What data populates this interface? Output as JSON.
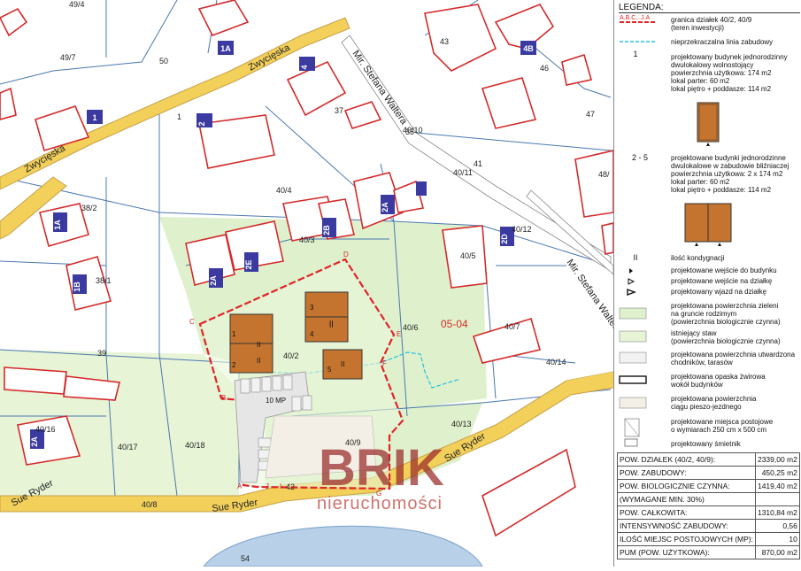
{
  "map": {
    "parcels": [
      "49/4",
      "49/7",
      "50",
      "1",
      "35",
      "37",
      "40/10",
      "41",
      "40/11",
      "40/4",
      "38/2",
      "40/3",
      "38/1",
      "40/12",
      "40/5",
      "48/",
      "47",
      "46",
      "43",
      "39",
      "40/2",
      "40/6",
      "40/7",
      "40/14",
      "40/13",
      "40/16",
      "40/17",
      "40/18",
      "40/8",
      "40/9",
      "42",
      "54"
    ],
    "buildings": [
      "1A",
      "4",
      "4B",
      "1",
      "2",
      "2A",
      "2B",
      "2A",
      "2E",
      "2D",
      "1B",
      "1A",
      "2A"
    ],
    "streets": [
      "Zwycięska",
      "Zwycięska",
      "Mir. Stefana Waltera",
      "Mir. Stefana Waltera",
      "Sue Ryder",
      "Sue Ryder",
      "Sue Ryder"
    ],
    "zone": "05-04",
    "corners": [
      "A",
      "B",
      "C",
      "D",
      "E",
      "F",
      "G",
      "I",
      "J"
    ],
    "parking": "10 MP",
    "new_buildings": [
      {
        "no": "1",
        "tag": "II"
      },
      {
        "no": "2",
        "tag": "II"
      },
      {
        "no": "3",
        "tag": "II"
      },
      {
        "no": "4",
        "tag": "II"
      },
      {
        "no": "5",
        "tag": "II"
      }
    ],
    "watermark": {
      "brand": "BRIK",
      "sub": "nieruchomości"
    }
  },
  "legend": {
    "title": "LEGENDA:",
    "plot_corner_label": "A.B.C...J.A",
    "items": [
      {
        "lines": [
          "granica działek 40/2, 40/9",
          "(teren inwestycji)"
        ]
      },
      {
        "lines": [
          "nieprzekraczalna linia zabudowy"
        ]
      },
      {
        "lines": [
          "projektowany budynek jednorodzinny",
          "dwulokalowy wolnostojący",
          "powierzchnia użytkowa: 174 m2",
          "lokal parter: 60 m2",
          "lokal piętro + poddasze: 114 m2"
        ]
      },
      {
        "lines": [
          "projektowane budynki jednorodzinne",
          "dwulokalowe w zabudowie bliźniaczej",
          "powierzchnia użytkowa: 2 x 174 m2",
          "lokal parter: 60 m2",
          "lokal piętro + poddasze: 114 m2"
        ]
      },
      {
        "lines": [
          "ilość kondygnacji"
        ]
      },
      {
        "lines": [
          "projektowane wejście do budynku"
        ]
      },
      {
        "lines": [
          "projektowane wejście na działkę"
        ]
      },
      {
        "lines": [
          "projektowany wjazd na działkę"
        ]
      },
      {
        "lines": [
          "projektowana powierzchnia zieleni",
          "na gruncie rodzimym",
          "(powierzchnia biologicznie czynna)"
        ]
      },
      {
        "lines": [
          "istniejący staw",
          "(powierzchnia biologicznie czynna)"
        ]
      },
      {
        "lines": [
          "projektowana powierzchnia utwardzona",
          "chodników, tarasów"
        ]
      },
      {
        "lines": [
          "projektowana opaska żwirowa",
          "wokół budynków"
        ]
      },
      {
        "lines": [
          "projektowana powierzchnia",
          "ciągu pieszo-jezdnego"
        ]
      },
      {
        "lines": [
          "projektowane miejsca postojowe",
          "o wymiarach 250 cm x 500 cm"
        ]
      },
      {
        "lines": [
          "projektowany śmietnik"
        ]
      }
    ],
    "markers": {
      "one": "1",
      "range": "2 - 5",
      "floors": "II"
    }
  },
  "stats": [
    {
      "label": "POW. DZIAŁEK (40/2, 40/9):",
      "value": "2339,00 m2"
    },
    {
      "label": "POW. ZABUDOWY:",
      "value": "450,25 m2"
    },
    {
      "label": "POW. BIOLOGICZNIE CZYNNA:",
      "value": "1419,40 m2"
    },
    {
      "label": "(WYMAGANE MIN. 30%)",
      "value": ""
    },
    {
      "label": "POW. CAŁKOWITA:",
      "value": "1310,84 m2"
    },
    {
      "label": "INTENSYWNOŚĆ ZABUDOWY:",
      "value": "0,56"
    },
    {
      "label": "ILOŚĆ MIEJSC POSTOJOWYCH (MP):",
      "value": "10"
    },
    {
      "label": "PUM (POW. UŻYTKOWA):",
      "value": "870,00 m2"
    }
  ],
  "colors": {
    "road": "#f2d05a",
    "road_edge": "#c8a24a",
    "parcel": "#4a78b0",
    "building": "#d42a2a",
    "new_building": "#c4742e",
    "green": "#dcefc8",
    "site_border": "#e0242a",
    "building_line": "#27c0e0",
    "badge": "#3a3aa0",
    "watermark": "#9a2a2a"
  }
}
